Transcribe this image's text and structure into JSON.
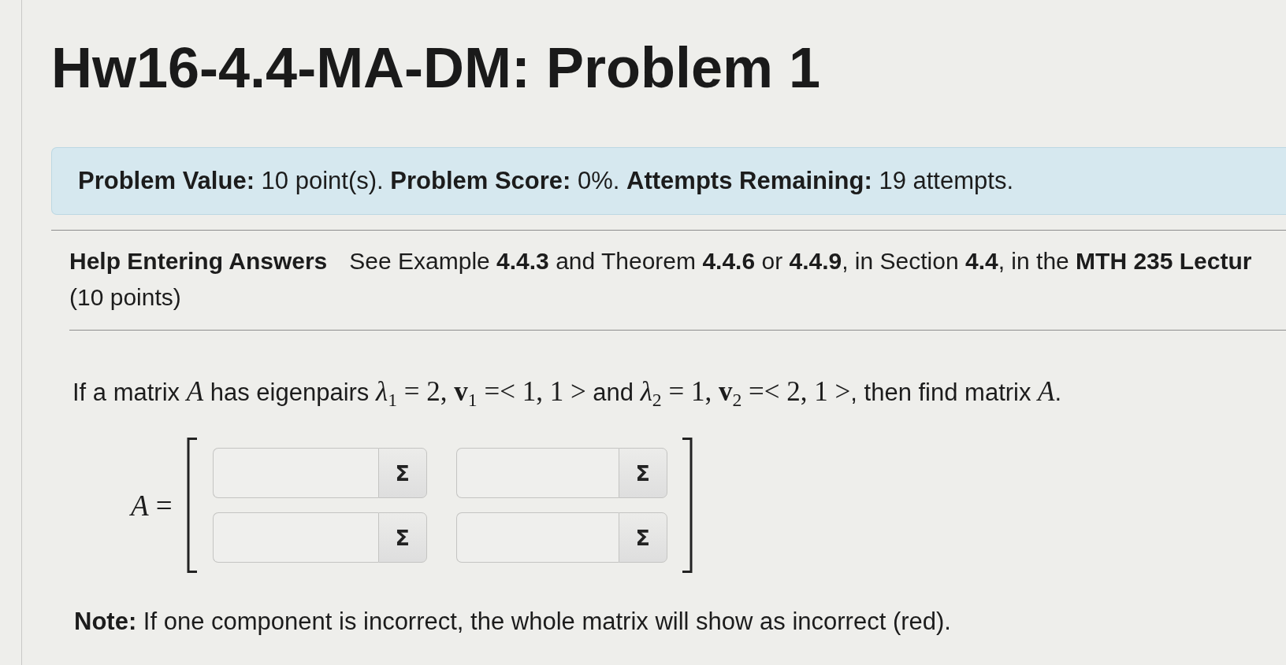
{
  "title": "Hw16-4.4-MA-DM: Problem 1",
  "problem_info": "**Problem Value:** 10 point(s). **Problem Score:** 0%. **Attempts Remaining:** 19 attempts.",
  "help_link": "Help Entering Answers",
  "instructions": "See Example **4.4.3** and Theorem **4.4.6** or **4.4.9**, in Section **4.4**, in the **MTH 235 Lectur**",
  "points": "(10 points)",
  "question": [
    {
      "kind": "text",
      "text": "If a matrix "
    },
    {
      "kind": "math",
      "text": "*A*"
    },
    {
      "kind": "text",
      "text": " has eigenpairs "
    },
    {
      "kind": "math",
      "text": "*λ*$_{1}$ = 2, **v**$_{1}$ =< 1, 1 >"
    },
    {
      "kind": "text",
      "text": " and "
    },
    {
      "kind": "math",
      "text": "*λ*$_{2}$ = 1, **v**$_{2}$ =< 2, 1 >"
    },
    {
      "kind": "text",
      "text": ", then find matrix "
    },
    {
      "kind": "math",
      "text": "*A*"
    },
    {
      "kind": "text",
      "text": "."
    }
  ],
  "matrix": {
    "label": "*A* =",
    "rows": [
      [
        {
          "button": "Σ"
        },
        {
          "button": "Σ"
        }
      ],
      [
        {
          "button": "Σ"
        },
        {
          "button": "Σ"
        }
      ]
    ]
  },
  "note": "**Note:** If one component is incorrect, the whole matrix will show as incorrect (red)."
}
